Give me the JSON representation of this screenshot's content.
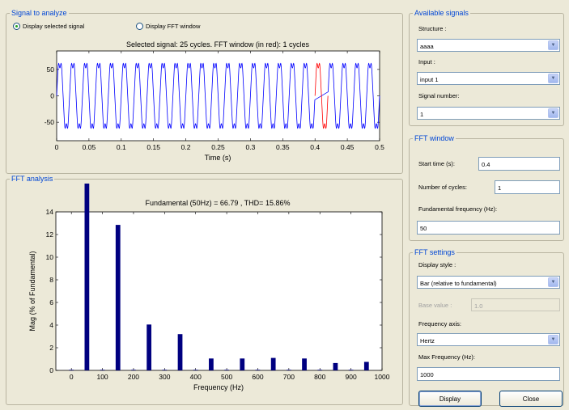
{
  "signal_panel": {
    "title": "Signal to analyze",
    "radio_display_selected": "Display selected signal",
    "radio_display_fft": "Display FFT window",
    "plot_title": "Selected signal: 25 cycles. FFT window (in red): 1 cycles",
    "xlabel": "Time (s)",
    "y_ticks": [
      "50",
      "0",
      "-50"
    ],
    "x_ticks": [
      "0",
      "0.05",
      "0.1",
      "0.15",
      "0.2",
      "0.25",
      "0.3",
      "0.35",
      "0.4",
      "0.45",
      "0.5"
    ]
  },
  "fft_panel": {
    "title": "FFT analysis",
    "plot_title": "Fundamental (50Hz) = 66.79 , THD= 15.86%"
  },
  "available_signals": {
    "title": "Available signals",
    "structure_label": "Structure :",
    "structure_value": "aaaa",
    "input_label": "Input :",
    "input_value": "input 1",
    "signal_number_label": "Signal number:",
    "signal_number_value": "1"
  },
  "fft_window": {
    "title": "FFT window",
    "start_time_label": "Start time (s):",
    "start_time_value": "0.4",
    "num_cycles_label": "Number of cycles:",
    "num_cycles_value": "1",
    "fund_freq_label": "Fundamental frequency (Hz):",
    "fund_freq_value": "50"
  },
  "fft_settings": {
    "title": "FFT settings",
    "display_style_label": "Display style :",
    "display_style_value": "Bar (relative to fundamental)",
    "base_value_label": "Base value :",
    "base_value_value": "1.0",
    "freq_axis_label": "Frequency axis:",
    "freq_axis_value": "Hertz",
    "max_freq_label": "Max Frequency (Hz):",
    "max_freq_value": "1000"
  },
  "buttons": {
    "display": "Display",
    "close": "Close"
  },
  "colors": {
    "signal_line": "#0000ff",
    "fft_window_line": "#ff0000",
    "bar_fill": "#000080",
    "title_blue": "#0046d5"
  },
  "chart_data": [
    {
      "type": "line",
      "title": "Selected signal: 25 cycles. FFT window (in red): 1 cycles",
      "xlabel": "Time (s)",
      "ylabel": "",
      "xlim": [
        0,
        0.5
      ],
      "ylim": [
        -85,
        85
      ],
      "fundamental_hz": 50,
      "amplitude": 66.79,
      "cycles": 25,
      "highlight_window": [
        0.4,
        0.42
      ],
      "x_ticks": [
        0,
        0.05,
        0.1,
        0.15,
        0.2,
        0.25,
        0.3,
        0.35,
        0.4,
        0.45,
        0.5
      ],
      "y_ticks": [
        50,
        0,
        -50
      ]
    },
    {
      "type": "bar",
      "title": "Fundamental (50Hz) = 66.79 , THD= 15.86%",
      "xlabel": "Frequency (Hz)",
      "ylabel": "Mag (% of Fundamental)",
      "xlim": [
        -50,
        1000
      ],
      "ylim": [
        0,
        14
      ],
      "x_ticks": [
        0,
        100,
        200,
        300,
        400,
        500,
        600,
        700,
        800,
        900,
        1000
      ],
      "y_ticks": [
        0,
        2,
        4,
        6,
        8,
        10,
        12,
        14
      ],
      "x": [
        0,
        50,
        100,
        150,
        200,
        250,
        300,
        350,
        400,
        450,
        500,
        550,
        600,
        650,
        700,
        750,
        800,
        850,
        900,
        950
      ],
      "values": [
        0.05,
        16.5,
        0.05,
        12.85,
        0.05,
        4.05,
        0.05,
        3.2,
        0.05,
        1.05,
        0.05,
        1.05,
        0.05,
        1.1,
        0.05,
        1.05,
        0.05,
        0.65,
        0.05,
        0.75
      ]
    }
  ]
}
